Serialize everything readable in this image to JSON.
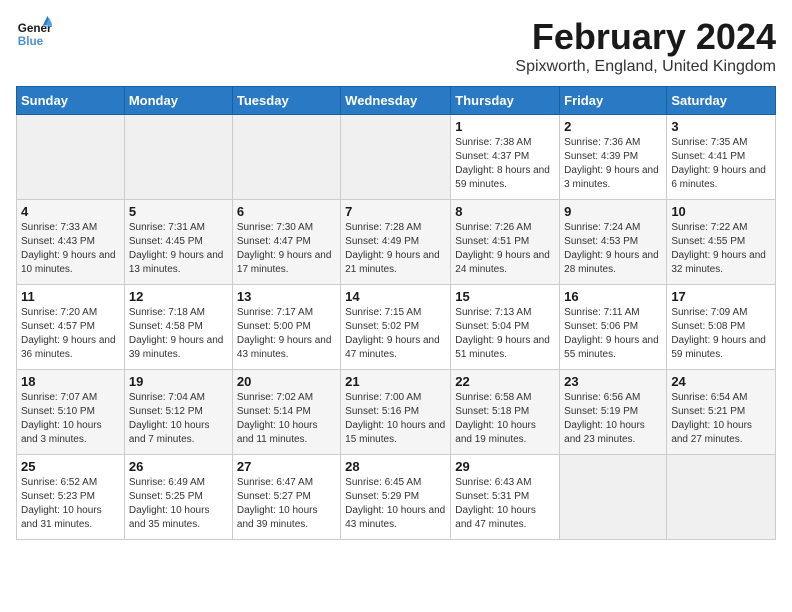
{
  "logo": {
    "line1": "General",
    "line2": "Blue"
  },
  "title": "February 2024",
  "subtitle": "Spixworth, England, United Kingdom",
  "days_of_week": [
    "Sunday",
    "Monday",
    "Tuesday",
    "Wednesday",
    "Thursday",
    "Friday",
    "Saturday"
  ],
  "weeks": [
    [
      {
        "day": "",
        "info": ""
      },
      {
        "day": "",
        "info": ""
      },
      {
        "day": "",
        "info": ""
      },
      {
        "day": "",
        "info": ""
      },
      {
        "day": "1",
        "info": "Sunrise: 7:38 AM\nSunset: 4:37 PM\nDaylight: 8 hours\nand 59 minutes."
      },
      {
        "day": "2",
        "info": "Sunrise: 7:36 AM\nSunset: 4:39 PM\nDaylight: 9 hours\nand 3 minutes."
      },
      {
        "day": "3",
        "info": "Sunrise: 7:35 AM\nSunset: 4:41 PM\nDaylight: 9 hours\nand 6 minutes."
      }
    ],
    [
      {
        "day": "4",
        "info": "Sunrise: 7:33 AM\nSunset: 4:43 PM\nDaylight: 9 hours\nand 10 minutes."
      },
      {
        "day": "5",
        "info": "Sunrise: 7:31 AM\nSunset: 4:45 PM\nDaylight: 9 hours\nand 13 minutes."
      },
      {
        "day": "6",
        "info": "Sunrise: 7:30 AM\nSunset: 4:47 PM\nDaylight: 9 hours\nand 17 minutes."
      },
      {
        "day": "7",
        "info": "Sunrise: 7:28 AM\nSunset: 4:49 PM\nDaylight: 9 hours\nand 21 minutes."
      },
      {
        "day": "8",
        "info": "Sunrise: 7:26 AM\nSunset: 4:51 PM\nDaylight: 9 hours\nand 24 minutes."
      },
      {
        "day": "9",
        "info": "Sunrise: 7:24 AM\nSunset: 4:53 PM\nDaylight: 9 hours\nand 28 minutes."
      },
      {
        "day": "10",
        "info": "Sunrise: 7:22 AM\nSunset: 4:55 PM\nDaylight: 9 hours\nand 32 minutes."
      }
    ],
    [
      {
        "day": "11",
        "info": "Sunrise: 7:20 AM\nSunset: 4:57 PM\nDaylight: 9 hours\nand 36 minutes."
      },
      {
        "day": "12",
        "info": "Sunrise: 7:18 AM\nSunset: 4:58 PM\nDaylight: 9 hours\nand 39 minutes."
      },
      {
        "day": "13",
        "info": "Sunrise: 7:17 AM\nSunset: 5:00 PM\nDaylight: 9 hours\nand 43 minutes."
      },
      {
        "day": "14",
        "info": "Sunrise: 7:15 AM\nSunset: 5:02 PM\nDaylight: 9 hours\nand 47 minutes."
      },
      {
        "day": "15",
        "info": "Sunrise: 7:13 AM\nSunset: 5:04 PM\nDaylight: 9 hours\nand 51 minutes."
      },
      {
        "day": "16",
        "info": "Sunrise: 7:11 AM\nSunset: 5:06 PM\nDaylight: 9 hours\nand 55 minutes."
      },
      {
        "day": "17",
        "info": "Sunrise: 7:09 AM\nSunset: 5:08 PM\nDaylight: 9 hours\nand 59 minutes."
      }
    ],
    [
      {
        "day": "18",
        "info": "Sunrise: 7:07 AM\nSunset: 5:10 PM\nDaylight: 10 hours\nand 3 minutes."
      },
      {
        "day": "19",
        "info": "Sunrise: 7:04 AM\nSunset: 5:12 PM\nDaylight: 10 hours\nand 7 minutes."
      },
      {
        "day": "20",
        "info": "Sunrise: 7:02 AM\nSunset: 5:14 PM\nDaylight: 10 hours\nand 11 minutes."
      },
      {
        "day": "21",
        "info": "Sunrise: 7:00 AM\nSunset: 5:16 PM\nDaylight: 10 hours\nand 15 minutes."
      },
      {
        "day": "22",
        "info": "Sunrise: 6:58 AM\nSunset: 5:18 PM\nDaylight: 10 hours\nand 19 minutes."
      },
      {
        "day": "23",
        "info": "Sunrise: 6:56 AM\nSunset: 5:19 PM\nDaylight: 10 hours\nand 23 minutes."
      },
      {
        "day": "24",
        "info": "Sunrise: 6:54 AM\nSunset: 5:21 PM\nDaylight: 10 hours\nand 27 minutes."
      }
    ],
    [
      {
        "day": "25",
        "info": "Sunrise: 6:52 AM\nSunset: 5:23 PM\nDaylight: 10 hours\nand 31 minutes."
      },
      {
        "day": "26",
        "info": "Sunrise: 6:49 AM\nSunset: 5:25 PM\nDaylight: 10 hours\nand 35 minutes."
      },
      {
        "day": "27",
        "info": "Sunrise: 6:47 AM\nSunset: 5:27 PM\nDaylight: 10 hours\nand 39 minutes."
      },
      {
        "day": "28",
        "info": "Sunrise: 6:45 AM\nSunset: 5:29 PM\nDaylight: 10 hours\nand 43 minutes."
      },
      {
        "day": "29",
        "info": "Sunrise: 6:43 AM\nSunset: 5:31 PM\nDaylight: 10 hours\nand 47 minutes."
      },
      {
        "day": "",
        "info": ""
      },
      {
        "day": "",
        "info": ""
      }
    ]
  ]
}
